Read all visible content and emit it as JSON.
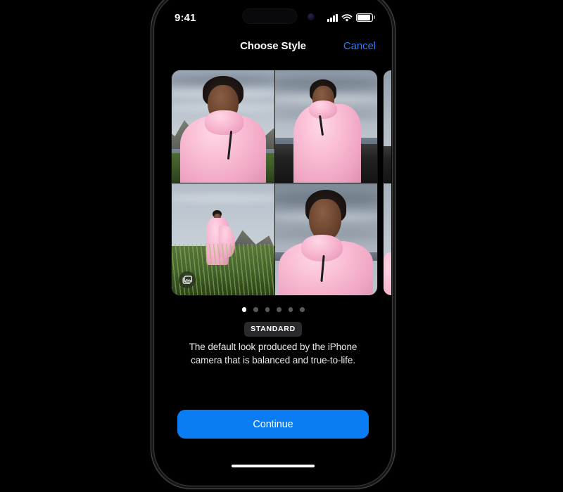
{
  "device": {
    "status_bar": {
      "time": "9:41",
      "signal_icon": "cellular-signal-icon",
      "wifi_icon": "wifi-icon",
      "battery_icon": "battery-icon",
      "dynamic_island": "dynamic-island",
      "camera_dot": "front-camera-dot"
    },
    "home_indicator": "home-indicator"
  },
  "nav": {
    "title": "Choose Style",
    "cancel_label": "Cancel"
  },
  "carousel": {
    "photo_stack_icon": "photo-stack-icon",
    "cards": [
      {
        "name": "standard-style-card",
        "photos": 4
      },
      {
        "name": "next-style-card-peek",
        "photos": 0
      }
    ]
  },
  "pagination": {
    "total": 6,
    "active_index": 0,
    "dots": [
      {
        "label": "page-1",
        "active": true
      },
      {
        "label": "page-2",
        "active": false
      },
      {
        "label": "page-3",
        "active": false
      },
      {
        "label": "page-4",
        "active": false
      },
      {
        "label": "page-5",
        "active": false
      },
      {
        "label": "page-6",
        "active": false
      }
    ]
  },
  "style": {
    "badge": "STANDARD",
    "description": "The default look produced by the iPhone camera that is balanced and true-to-life."
  },
  "footer": {
    "continue_label": "Continue"
  },
  "colors": {
    "accent_blue": "#0a7cf4",
    "cancel_blue": "#2b7cf6",
    "background": "#000000",
    "badge_bg": "#2a2a2c",
    "dot_inactive": "#5a5a5e",
    "dot_active": "#ffffff"
  }
}
